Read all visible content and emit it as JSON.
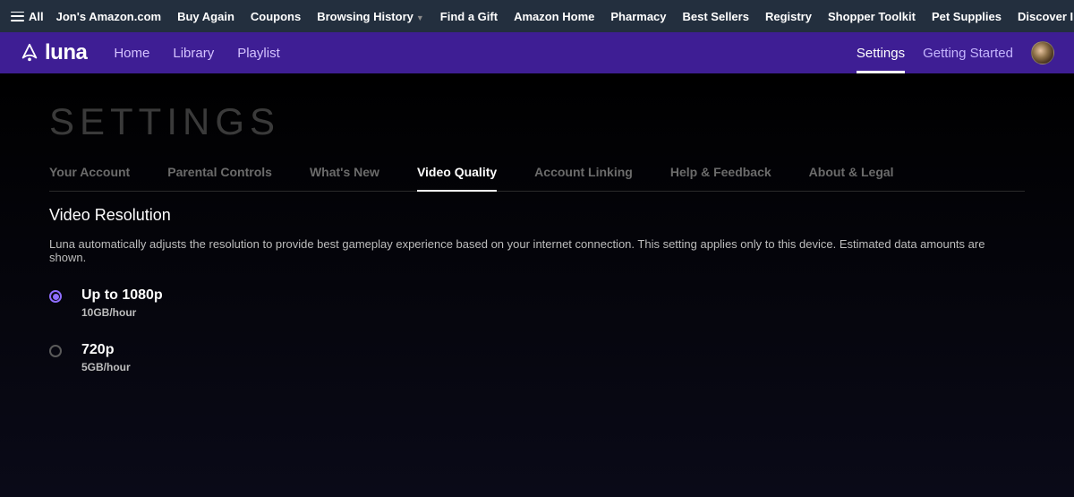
{
  "topnav": {
    "all": "All",
    "links": [
      "Jon's Amazon.com",
      "Buy Again",
      "Coupons",
      "Browsing History",
      "Find a Gift",
      "Amazon Home",
      "Pharmacy",
      "Best Sellers",
      "Registry",
      "Shopper Toolkit",
      "Pet Supplies"
    ],
    "dropdown_index": 3,
    "promo": "Discover Indie Beauty"
  },
  "luna_nav": {
    "brand": "luna",
    "left": [
      "Home",
      "Library",
      "Playlist"
    ],
    "right": [
      "Settings",
      "Getting Started"
    ],
    "right_active_index": 0
  },
  "page": {
    "title": "SETTINGS",
    "tabs": [
      "Your Account",
      "Parental Controls",
      "What's New",
      "Video Quality",
      "Account Linking",
      "Help & Feedback",
      "About & Legal"
    ],
    "active_tab_index": 3,
    "section_title": "Video Resolution",
    "description": "Luna automatically adjusts the resolution to provide best gameplay experience based on your internet connection. This setting applies only to this device. Estimated data amounts are shown.",
    "options": [
      {
        "title": "Up to 1080p",
        "sub": "10GB/hour",
        "selected": true
      },
      {
        "title": "720p",
        "sub": "5GB/hour",
        "selected": false
      }
    ]
  }
}
